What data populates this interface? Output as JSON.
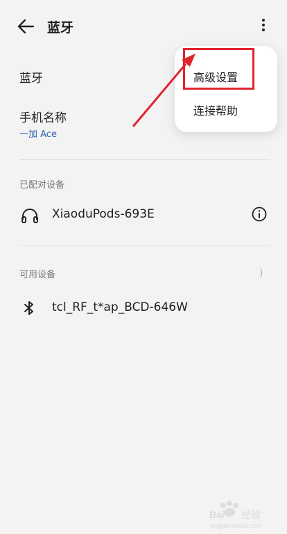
{
  "header": {
    "title": "蓝牙"
  },
  "settings": {
    "bluetooth_label": "蓝牙",
    "device_name_label": "手机名称",
    "device_name_value": "一加 Ace"
  },
  "paired": {
    "section_label": "已配对设备",
    "devices": [
      {
        "name": "XiaoduPods-693E",
        "icon": "headphones-icon"
      }
    ]
  },
  "available": {
    "section_label": "可用设备",
    "devices": [
      {
        "name": "tcl_RF_t*ap_BCD-646W",
        "icon": "bluetooth-icon"
      }
    ]
  },
  "menu": {
    "items": [
      {
        "label": "高级设置"
      },
      {
        "label": "连接帮助"
      }
    ]
  },
  "annotation": {
    "color": "#e0232d"
  },
  "watermark": {
    "text": "Baidu 经验",
    "url": "jingyan.baidu.com"
  }
}
